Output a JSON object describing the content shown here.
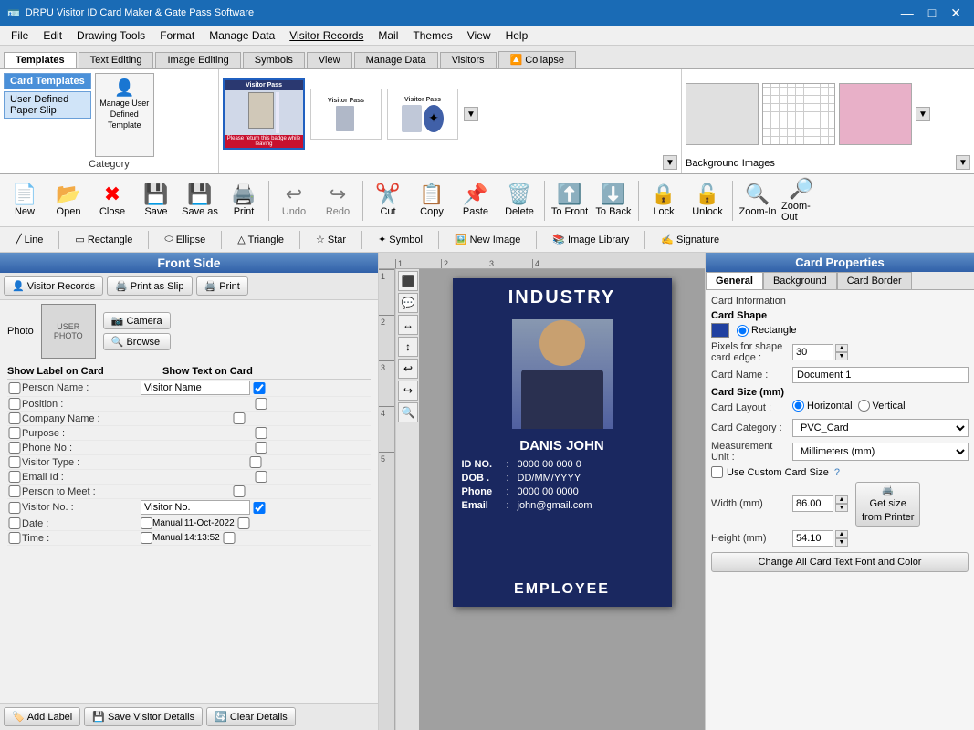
{
  "app": {
    "title": "DRPU Visitor ID Card Maker & Gate Pass Software",
    "icon": "🪪"
  },
  "titlebar": {
    "minimize": "—",
    "maximize": "□",
    "close": "✕"
  },
  "menu": {
    "items": [
      "File",
      "Edit",
      "Drawing Tools",
      "Format",
      "Manage Data",
      "Visitor Records",
      "Mail",
      "Themes",
      "View",
      "Help"
    ]
  },
  "ribbon": {
    "tabs": [
      "Templates",
      "Text Editing",
      "Image Editing",
      "Symbols",
      "View",
      "Manage Data",
      "Visitors",
      "Collapse"
    ],
    "active_tab": "Templates",
    "category": {
      "label": "Category",
      "items": [
        "Card Templates",
        "User Defined Paper Slip"
      ],
      "manage_btn": "Manage User Defined Template"
    },
    "bg_images": {
      "label": "Background Images"
    }
  },
  "toolbar": {
    "buttons": [
      {
        "label": "New",
        "icon": "📄"
      },
      {
        "label": "Open",
        "icon": "📂"
      },
      {
        "label": "Close",
        "icon": "❌"
      },
      {
        "label": "Save",
        "icon": "💾"
      },
      {
        "label": "Save as",
        "icon": "💾"
      },
      {
        "label": "Print",
        "icon": "🖨️"
      },
      {
        "label": "Undo",
        "icon": "↩️"
      },
      {
        "label": "Redo",
        "icon": "↪️"
      },
      {
        "label": "Cut",
        "icon": "✂️"
      },
      {
        "label": "Copy",
        "icon": "📋"
      },
      {
        "label": "Paste",
        "icon": "📌"
      },
      {
        "label": "Delete",
        "icon": "🗑️"
      },
      {
        "label": "To Front",
        "icon": "⬆️"
      },
      {
        "label": "To Back",
        "icon": "⬇️"
      },
      {
        "label": "Lock",
        "icon": "🔒"
      },
      {
        "label": "Unlock",
        "icon": "🔓"
      },
      {
        "label": "Zoom-In",
        "icon": "🔍"
      },
      {
        "label": "Zoom-Out",
        "icon": "🔎"
      }
    ]
  },
  "drawing_toolbar": {
    "tools": [
      "Line",
      "Rectangle",
      "Ellipse",
      "Triangle",
      "Star",
      "Symbol",
      "New Image",
      "Image Library",
      "Signature"
    ]
  },
  "front_panel": {
    "title": "Front Side",
    "actions": [
      {
        "label": "Visitor Records",
        "icon": "👤"
      },
      {
        "label": "Print as Slip",
        "icon": "🖨️"
      },
      {
        "label": "Print",
        "icon": "🖨️"
      }
    ],
    "photo": {
      "label": "Photo",
      "placeholder": "USER PHOTO",
      "buttons": [
        "Camera",
        "Browse"
      ]
    },
    "fields_header": {
      "col1": "Show Label on Card",
      "col2": "Show Text on Card"
    },
    "fields": [
      {
        "label": "Person Name :",
        "text": "",
        "has_text_input": false,
        "checked": false
      },
      {
        "label": "Position :",
        "text": "",
        "has_text_input": false,
        "checked": false
      },
      {
        "label": "Company Name :",
        "text": "",
        "has_text_input": false,
        "checked": false
      },
      {
        "label": "Purpose :",
        "text": "",
        "has_text_input": false,
        "checked": false
      },
      {
        "label": "Phone No :",
        "text": "",
        "has_text_input": false,
        "checked": false
      },
      {
        "label": "Visitor Type :",
        "text": "",
        "has_text_input": false,
        "checked": false
      },
      {
        "label": "Email Id :",
        "text": "",
        "has_text_input": false,
        "checked": false
      },
      {
        "label": "Person to Meet :",
        "text": "",
        "has_text_input": false,
        "checked": false
      },
      {
        "label": "Visitor No. :",
        "text": "Visitor No.",
        "has_text_input": true,
        "checked": true
      },
      {
        "label": "Date :",
        "text": "11-Oct-2022",
        "has_text_input": false,
        "is_manual": true,
        "checked": false
      },
      {
        "label": "Time :",
        "text": "14:13:52",
        "has_text_input": false,
        "is_manual": true,
        "checked": false
      }
    ],
    "bottom_buttons": [
      "Add Label",
      "Save Visitor Details",
      "Clear Details"
    ]
  },
  "card": {
    "top_text": "INDUSTRY",
    "name": "DANIS JOHN",
    "fields": [
      {
        "label": "ID NO.",
        "sep": ":",
        "value": "0000 00 000 0"
      },
      {
        "label": "DOB .",
        "sep": ":",
        "value": "DD/MM/YYYY"
      },
      {
        "label": "Phone",
        "sep": ":",
        "value": "0000 00 0000"
      },
      {
        "label": "Email",
        "sep": ":",
        "value": "john@gmail.com"
      }
    ],
    "bottom_text": "EMPLOYEE"
  },
  "visitor_name_input": "Visitor Name",
  "props": {
    "title": "Card Properties",
    "tabs": [
      "General",
      "Background",
      "Card Border"
    ],
    "active_tab": "General",
    "card_info_label": "Card Information",
    "card_shape_label": "Card Shape",
    "shape_options": [
      "Rectangle"
    ],
    "pixels_label": "Pixels for shape card edge :",
    "pixels_value": "30",
    "card_name_label": "Card Name :",
    "card_name_value": "Document 1",
    "card_size_label": "Card Size (mm)",
    "card_layout_label": "Card Layout :",
    "layout_options": [
      "Horizontal",
      "Vertical"
    ],
    "card_category_label": "Card Category :",
    "card_category_value": "PVC_Card",
    "measurement_label": "Measurement Unit :",
    "measurement_value": "Millimeters (mm)",
    "custom_size_label": "Use Custom Card Size",
    "width_label": "Width (mm)",
    "width_value": "86.00",
    "height_label": "Height (mm)",
    "height_value": "54.10",
    "get_size_btn": "Get size from Printer",
    "change_font_btn": "Change All Card Text Font and Color"
  }
}
